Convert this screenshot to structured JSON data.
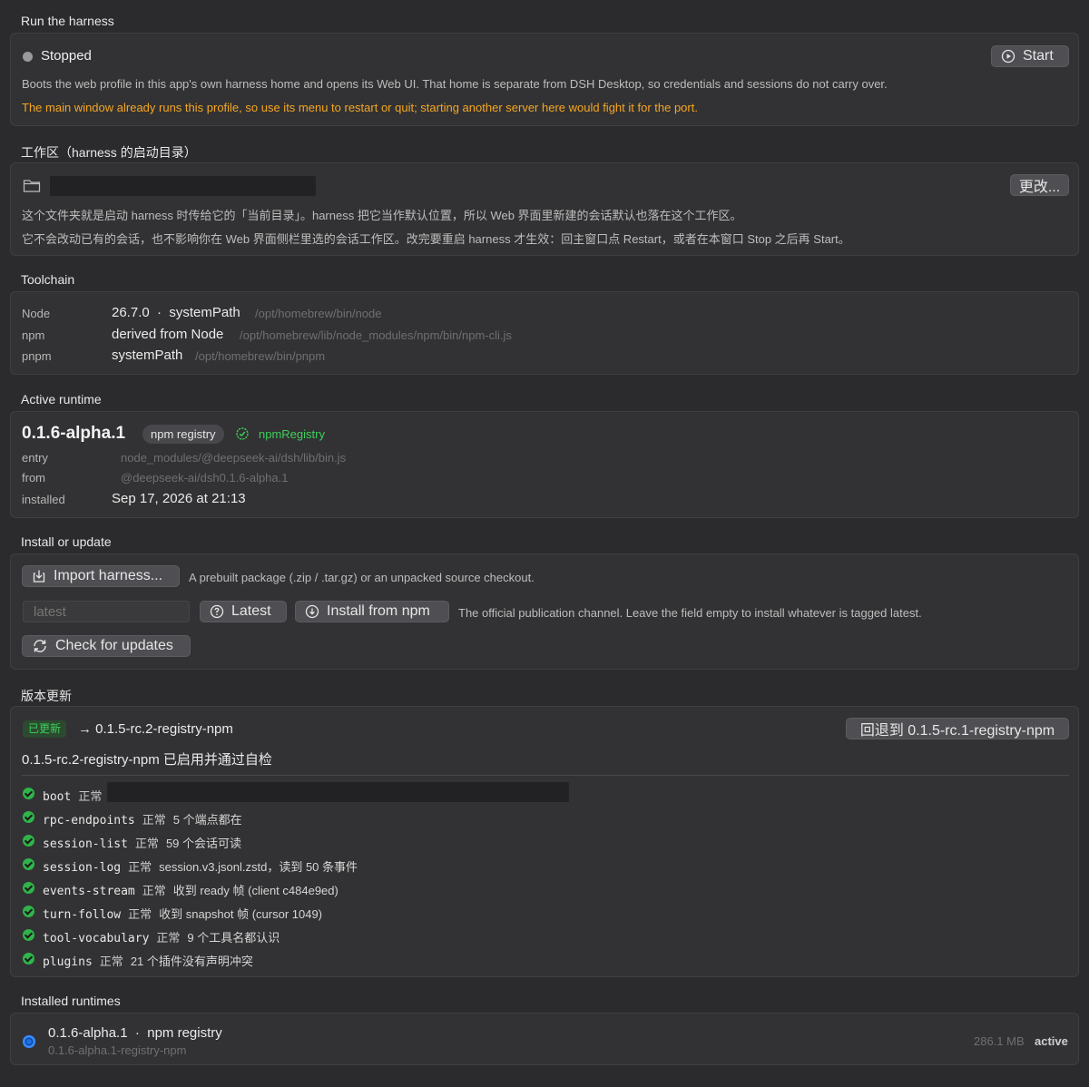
{
  "run": {
    "section_title": "Run the harness",
    "status": "Stopped",
    "start_label": "Start",
    "description": "Boots the web profile in this app's own harness home and opens its Web UI. That home is separate from DSH Desktop, so credentials and sessions do not carry over.",
    "warning": "The main window already runs this profile, so use its menu to restart or quit; starting another server here would fight it for the port.",
    "warning_color": "#f5a623"
  },
  "workspace": {
    "section_title": "工作区（harness 的启动目录）",
    "change_label": "更改...",
    "line1": "这个文件夹就是启动 harness 时传给它的「当前目录」。harness 把它当作默认位置，所以 Web 界面里新建的会话默认也落在这个工作区。",
    "line2": "它不会改动已有的会话，也不影响你在 Web 界面侧栏里选的会话工作区。改完要重启 harness 才生效：回主窗口点 Restart，或者在本窗口 Stop 之后再 Start。"
  },
  "toolchain": {
    "section_title": "Toolchain",
    "rows": [
      {
        "label": "Node",
        "value": "26.7.0  ·  systemPath",
        "path": "/opt/homebrew/bin/node"
      },
      {
        "label": "npm",
        "value": "derived from Node",
        "path": "/opt/homebrew/lib/node_modules/npm/bin/npm-cli.js"
      },
      {
        "label": "pnpm",
        "value": "systemPath",
        "path": "/opt/homebrew/bin/pnpm"
      }
    ]
  },
  "active_runtime": {
    "section_title": "Active runtime",
    "version": "0.1.6-alpha.1",
    "badge": "npm registry",
    "source": "npmRegistry",
    "source_color": "#3ecf5a",
    "rows": [
      {
        "label": "entry",
        "value": "node_modules/@deepseek-ai/dsh/lib/bin.js"
      },
      {
        "label": "from",
        "value": "@deepseek-ai/dsh0.1.6-alpha.1"
      },
      {
        "label": "installed",
        "value": "Sep 17, 2026 at 21:13"
      }
    ]
  },
  "install": {
    "section_title": "Install or update",
    "import_label": "Import harness...",
    "import_desc": "A prebuilt package (.zip / .tar.gz) or an unpacked source checkout.",
    "version_placeholder": "latest",
    "latest_label": "Latest",
    "install_label": "Install from npm",
    "install_desc": "The official publication channel. Leave the field empty to install whatever is tagged latest.",
    "check_label": "Check for updates"
  },
  "update": {
    "section_title": "版本更新",
    "badge": "已更新",
    "badge_color": "#3ecf5a",
    "target": "→ 0.1.5-rc.2-registry-npm",
    "rollback_label": "回退到 0.1.5-rc.1-registry-npm",
    "summary": "0.1.5-rc.2-registry-npm 已启用并通过自检",
    "checks": [
      {
        "name": "boot",
        "status": "正常",
        "detail": ""
      },
      {
        "name": "rpc-endpoints",
        "status": "正常",
        "detail": "5 个端点都在"
      },
      {
        "name": "session-list",
        "status": "正常",
        "detail": "59 个会话可读"
      },
      {
        "name": "session-log",
        "status": "正常",
        "detail": "session.v3.jsonl.zstd，读到 50 条事件"
      },
      {
        "name": "events-stream",
        "status": "正常",
        "detail": "收到 ready 帧 (client c484e9ed)"
      },
      {
        "name": "turn-follow",
        "status": "正常",
        "detail": "收到 snapshot 帧 (cursor 1049)"
      },
      {
        "name": "tool-vocabulary",
        "status": "正常",
        "detail": "9 个工具名都认识"
      },
      {
        "name": "plugins",
        "status": "正常",
        "detail": "21 个插件没有声明冲突"
      }
    ]
  },
  "installed": {
    "section_title": "Installed runtimes",
    "items": [
      {
        "title": "0.1.6-alpha.1  ·  npm registry",
        "subtitle": "0.1.6-alpha.1-registry-npm",
        "size": "286.1 MB",
        "state": "active"
      }
    ]
  }
}
